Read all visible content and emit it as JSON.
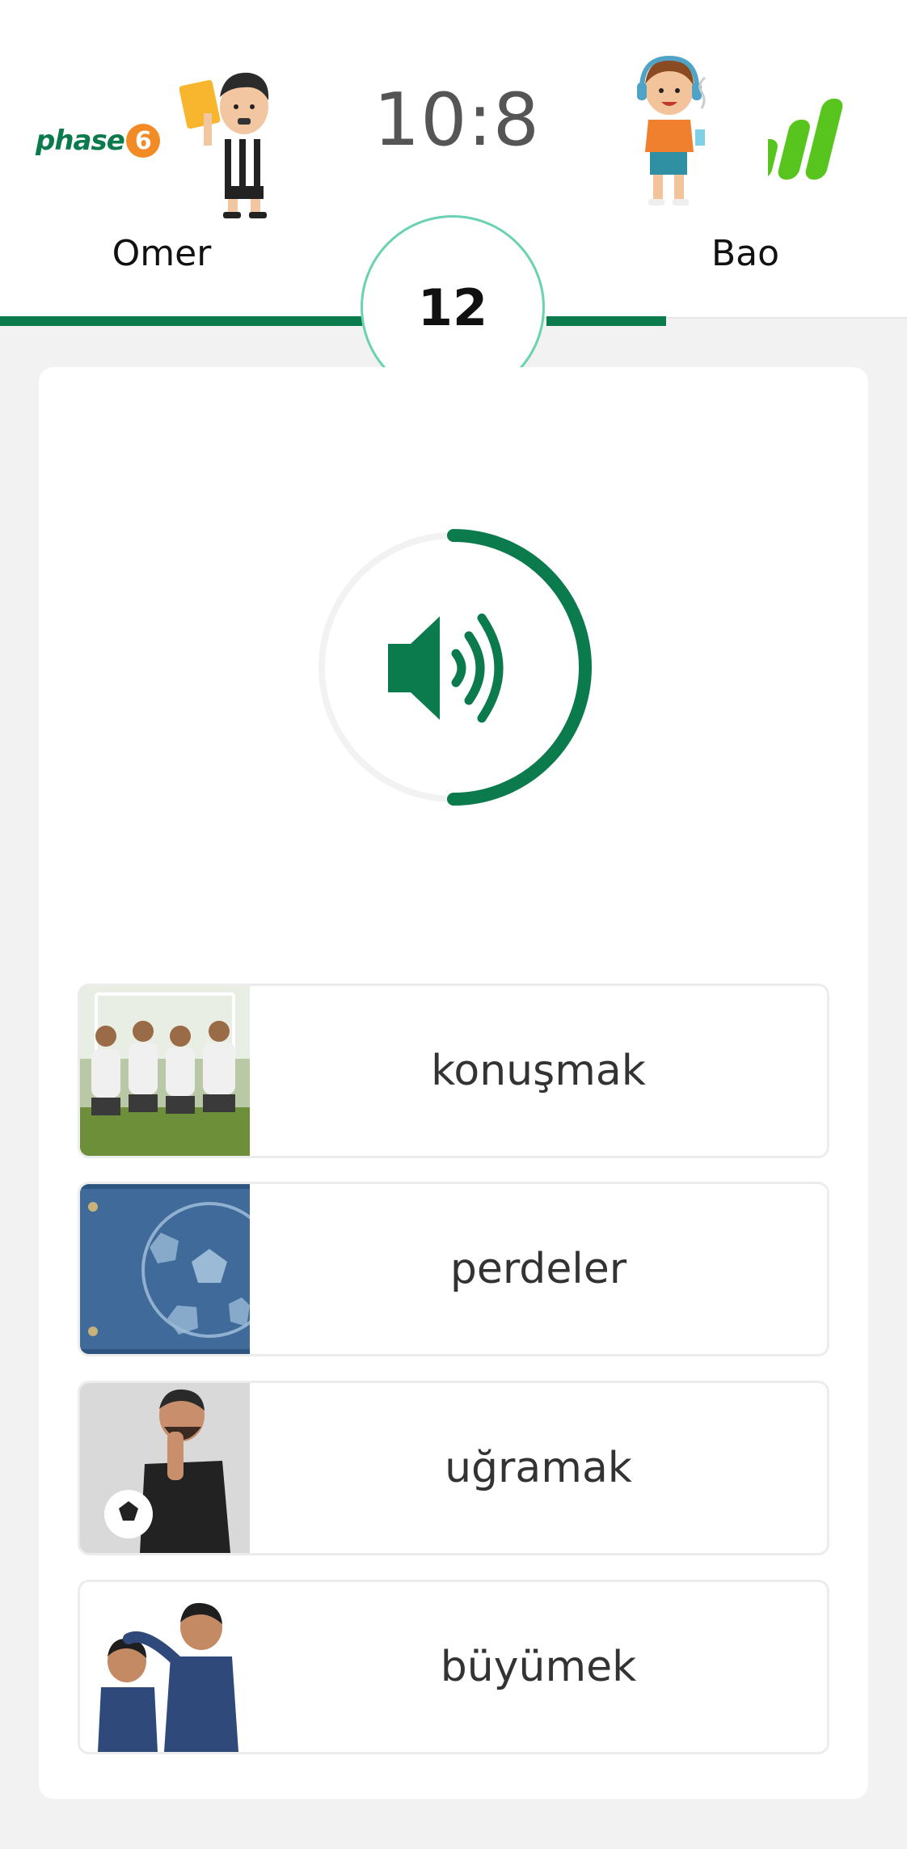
{
  "header": {
    "brand_left": "phase",
    "brand_left_badge": "6",
    "score": "10:8",
    "player_left": "Omer",
    "player_right": "Bao",
    "countdown": "12"
  },
  "audio": {
    "icon": "speaker-icon",
    "progress_fraction": 0.5
  },
  "options": [
    {
      "label": "konuşmak",
      "image": "soccer-team-photo"
    },
    {
      "label": "perdeler",
      "image": "denim-soccer-ball-photo"
    },
    {
      "label": "uğramak",
      "image": "man-with-ball-photo"
    },
    {
      "label": "büyümek",
      "image": "two-boys-photo"
    }
  ],
  "colors": {
    "accent": "#0b7a4c",
    "timer_ring": "#69d2b2",
    "brand_orange": "#f28b25",
    "logo_green": "#58c41e"
  }
}
